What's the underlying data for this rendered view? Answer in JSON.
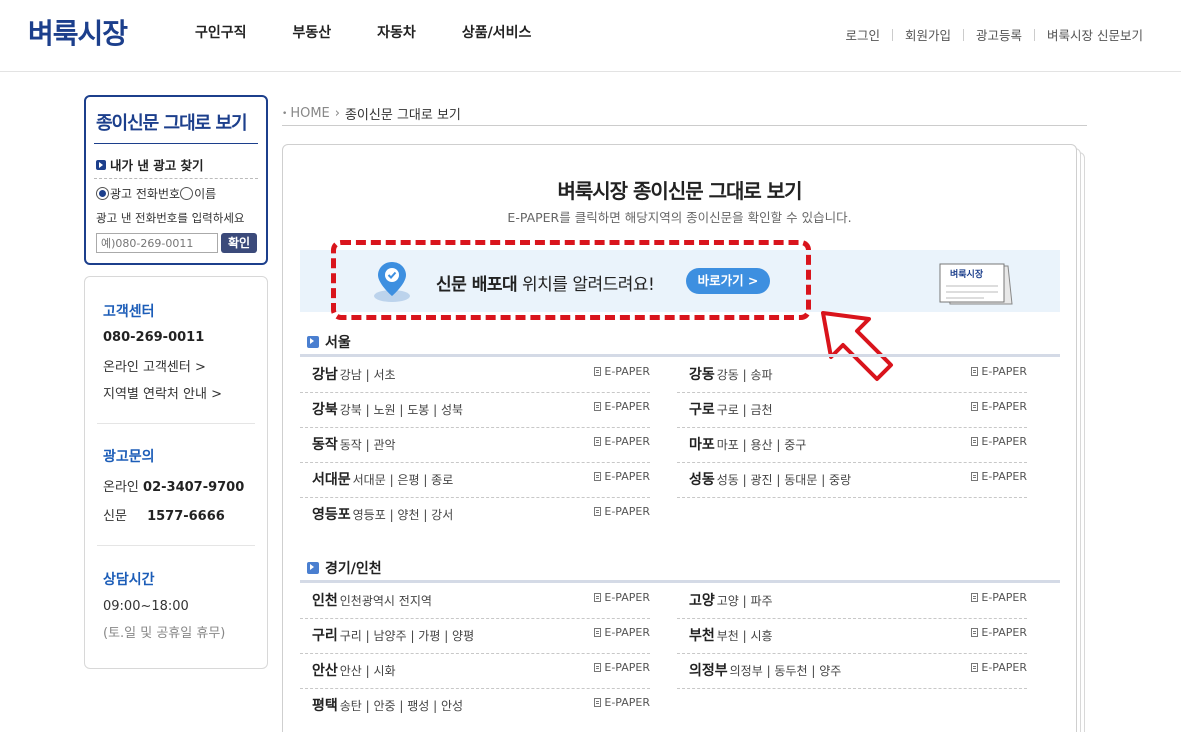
{
  "header": {
    "logo": "벼룩시장",
    "nav": [
      "구인구직",
      "부동산",
      "자동차",
      "상품/서비스"
    ],
    "util": [
      "로그인",
      "회원가입",
      "광고등록",
      "벼룩시장 신문보기"
    ]
  },
  "sidebar": {
    "paper_title": "종이신문 그대로 보기",
    "find_ad": "내가 낸 광고 찾기",
    "radio_phone": "광고 전화번호",
    "radio_name": "이름",
    "hint": "광고 낸 전화번호를 입력하세요",
    "phone_placeholder": "예)080-269-0011",
    "confirm": "확인",
    "cs_title": "고객센터",
    "cs_phone": "080-269-0011",
    "cs_online": "온라인 고객센터 >",
    "cs_regional": "지역별 연락처 안내 >",
    "ad_title": "광고문의",
    "ad_online_label": "온라인",
    "ad_online_phone": "02-3407-9700",
    "ad_paper_label": "신문",
    "ad_paper_phone": "1577-6666",
    "hours_title": "상담시간",
    "hours": "09:00~18:00",
    "hours_note": "(토.일 및 공휴일 휴무)"
  },
  "breadcrumb": {
    "home": "HOME",
    "current": "종이신문 그대로 보기"
  },
  "main": {
    "title": "벼룩시장 종이신문 그대로 보기",
    "subtitle": "E-PAPER를 클릭하면 해당지역의 종이신문을 확인할 수 있습니다.",
    "banner_bold": "신문 배포대",
    "banner_rest": " 위치를 알려드려요!",
    "banner_button": "바로가기 >",
    "banner_paper_label": "벼룩시장",
    "epaper": "E-PAPER"
  },
  "sections": [
    {
      "title": "서울",
      "regions": [
        {
          "name": "강남",
          "desc": "강남 | 서초"
        },
        {
          "name": "강동",
          "desc": "강동 | 송파"
        },
        {
          "name": "강북",
          "desc": "강북 | 노원 | 도봉 | 성북"
        },
        {
          "name": "구로",
          "desc": "구로 | 금천"
        },
        {
          "name": "동작",
          "desc": "동작 | 관악"
        },
        {
          "name": "마포",
          "desc": "마포 | 용산 | 중구"
        },
        {
          "name": "서대문",
          "desc": "서대문 | 은평 | 종로"
        },
        {
          "name": "성동",
          "desc": "성동 | 광진 | 동대문 | 중랑"
        },
        {
          "name": "영등포",
          "desc": "영등포 | 양천 | 강서"
        }
      ]
    },
    {
      "title": "경기/인천",
      "regions": [
        {
          "name": "인천",
          "desc": "인천광역시 전지역"
        },
        {
          "name": "고양",
          "desc": "고양 | 파주"
        },
        {
          "name": "구리",
          "desc": "구리 | 남양주 | 가평 | 양평"
        },
        {
          "name": "부천",
          "desc": "부천 | 시흥"
        },
        {
          "name": "안산",
          "desc": "안산 | 시화"
        },
        {
          "name": "의정부",
          "desc": "의정부 | 동두천 | 양주"
        },
        {
          "name": "평택",
          "desc": "송탄 | 안중 | 팽성 | 안성"
        }
      ]
    }
  ],
  "colors": {
    "brand": "#1c3f8c",
    "accent_blue": "#3d8fe0",
    "highlight_red": "#d9141c"
  }
}
